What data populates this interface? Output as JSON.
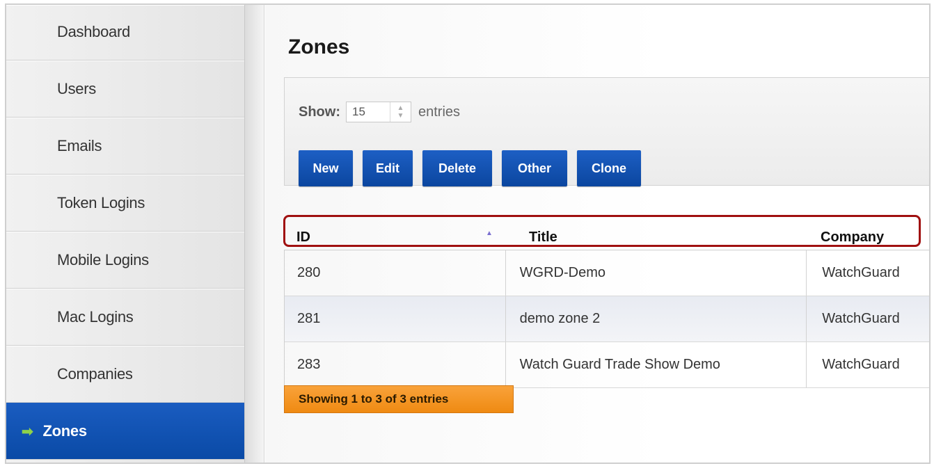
{
  "sidebar": {
    "items": [
      {
        "label": "Dashboard"
      },
      {
        "label": "Users"
      },
      {
        "label": "Emails"
      },
      {
        "label": "Token Logins"
      },
      {
        "label": "Mobile Logins"
      },
      {
        "label": "Mac Logins"
      },
      {
        "label": "Companies"
      },
      {
        "label": "Zones",
        "active": true,
        "icon": "arrow-right-icon",
        "icon_glyph": "➡"
      }
    ]
  },
  "main": {
    "title": "Zones",
    "show": {
      "label": "Show:",
      "value": "15",
      "suffix": "entries"
    },
    "buttons": [
      {
        "label": "New"
      },
      {
        "label": "Edit"
      },
      {
        "label": "Delete"
      },
      {
        "label": "Other"
      },
      {
        "label": "Clone"
      }
    ],
    "table": {
      "columns": [
        "ID",
        "Title",
        "Company"
      ],
      "rows": [
        {
          "id": "280",
          "title": "WGRD-Demo",
          "company": "WatchGuard"
        },
        {
          "id": "281",
          "title": "demo zone 2",
          "company": "WatchGuard"
        },
        {
          "id": "283",
          "title": "Watch Guard Trade Show Demo",
          "company": "WatchGuard"
        }
      ]
    },
    "info": "Showing 1 to 3 of 3 entries"
  },
  "colors": {
    "accent_blue": "#0b469f",
    "active_arrow": "#8fd24a",
    "info_orange": "#ef8a12",
    "highlight_red": "#a01010"
  }
}
